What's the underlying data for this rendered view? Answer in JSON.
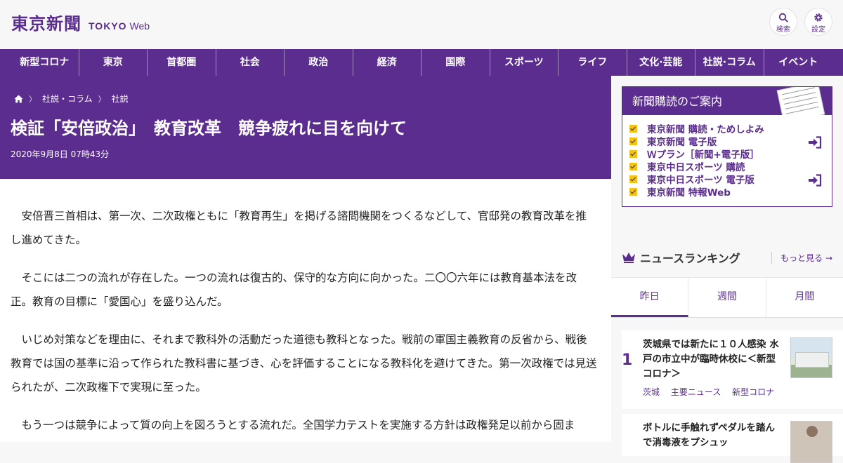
{
  "header": {
    "logo_main": "東京新聞",
    "logo_sub1": "TOKYO",
    "logo_sub2": "Web",
    "search_label": "検索",
    "settings_label": "設定"
  },
  "nav": {
    "items": [
      "新型コロナ",
      "東京",
      "首都圏",
      "社会",
      "政治",
      "経済",
      "国際",
      "スポーツ",
      "ライフ",
      "文化·芸能",
      "社説·コラム",
      "イベント"
    ]
  },
  "breadcrumb": {
    "items": [
      "社説・コラム",
      "社説"
    ]
  },
  "article": {
    "title": "検証「安倍政治」　教育改革　競争疲れに目を向けて",
    "date": "2020年9月8日 07時43分",
    "paragraphs": [
      "安倍晋三首相は、第一次、二次政権ともに「教育再生」を掲げる諮問機関をつくるなどして、官邸発の教育改革を推し進めてきた。",
      "そこには二つの流れが存在した。一つの流れは復古的、保守的な方向に向かった。二〇〇六年には教育基本法を改正。教育の目標に「愛国心」を盛り込んだ。",
      "いじめ対策などを理由に、それまで教科外の活動だった道徳も教科となった。戦前の軍国主義教育の反省から、戦後教育では国の基準に沿って作られた教科書に基づき、心を評価することになる教科化を避けてきた。第一次政権では見送られたが、二次政権下で実現に至った。",
      "もう一つは競争によって質の向上を図ろうとする流れだ。全国学力テストを実施する方針は政権発足以前から固ま"
    ]
  },
  "sidebar": {
    "promo": {
      "title": "新聞購読のご案内",
      "items": [
        "東京新聞 購読・ためしよみ",
        "東京新聞 電子版",
        "Ｗプラン［新聞+電子版］",
        "東京中日スポーツ 購読",
        "東京中日スポーツ 電子版",
        "東京新聞 特報Web"
      ]
    },
    "ranking": {
      "title": "ニュースランキング",
      "more": "もっと見る",
      "tabs": [
        "昨日",
        "週間",
        "月間"
      ],
      "items": [
        {
          "rank": "1",
          "text": "茨城県では新たに１０人感染 水戸の市立中が臨時休校に＜新型コロナ＞",
          "tags": [
            "茨城",
            "主要ニュース",
            "新型コロナ"
          ]
        },
        {
          "text": "ボトルに手触れずペダルを踏んで消毒液をプシュッ"
        }
      ]
    }
  },
  "colors": {
    "brand_purple": "#5b2d8e",
    "check_yellow": "#f2c21b"
  }
}
